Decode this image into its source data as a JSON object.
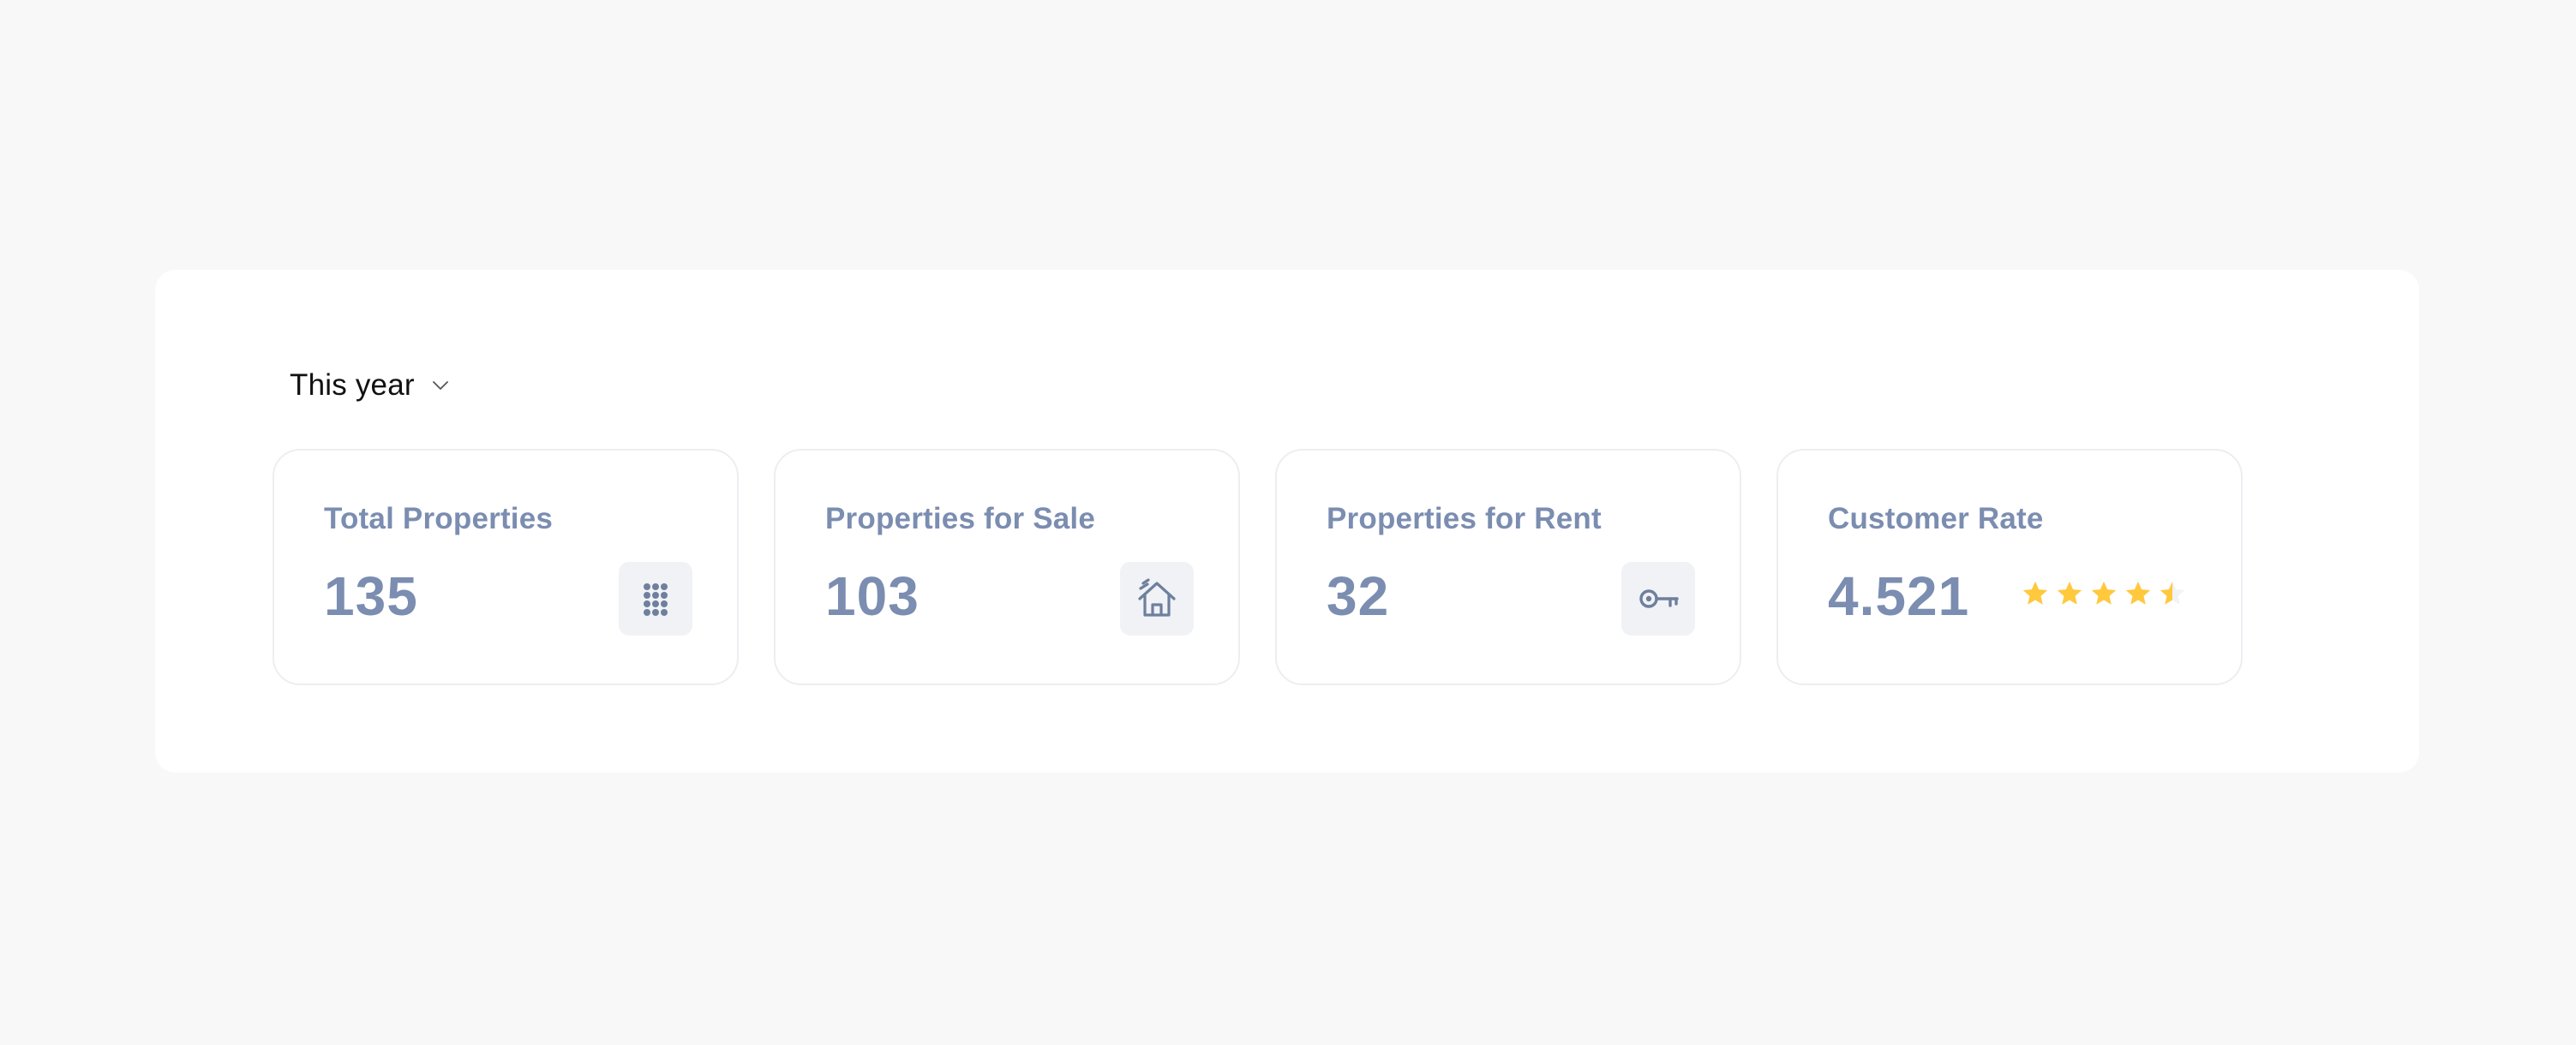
{
  "filter": {
    "period_label": "This year"
  },
  "cards": [
    {
      "title": "Total Properties",
      "value": "135",
      "icon": "grid-dots-icon"
    },
    {
      "title": "Properties for Sale",
      "value": "103",
      "icon": "house-icon"
    },
    {
      "title": "Properties for Rent",
      "value": "32",
      "icon": "key-icon"
    },
    {
      "title": "Customer Rate",
      "value": "4.521",
      "rating_stars": 4.5,
      "rating_max": 5
    }
  ],
  "colors": {
    "text_muted": "#7b8db0",
    "star": "#ffc83d",
    "card_border": "#eceef1",
    "icon_bg": "#f0f2f5"
  }
}
